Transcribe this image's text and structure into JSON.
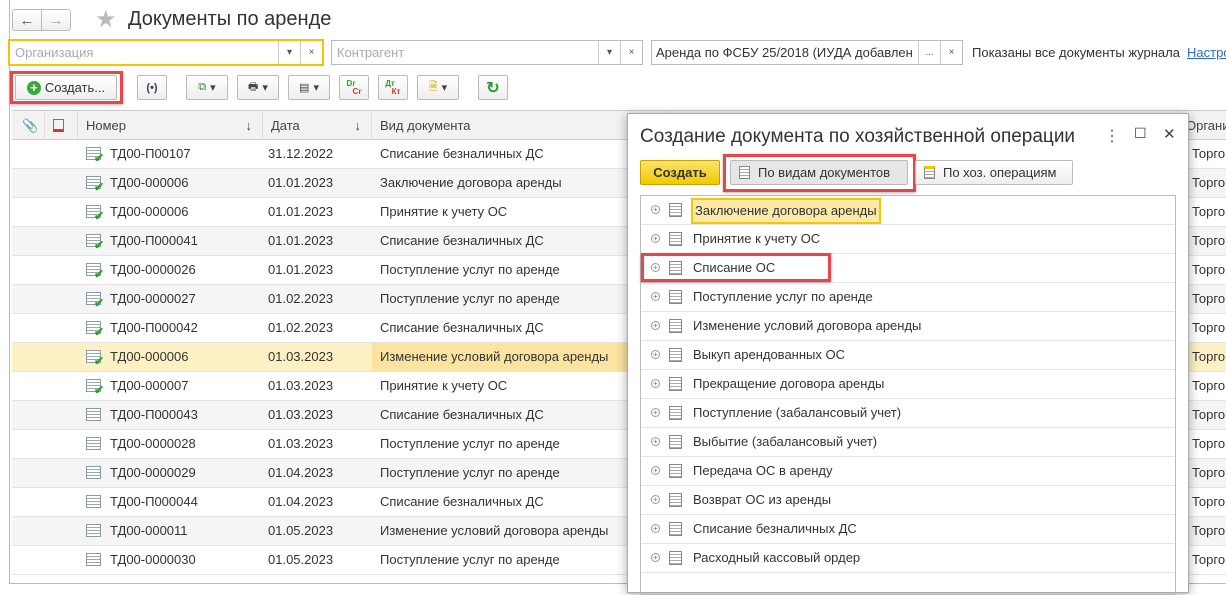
{
  "header": {
    "back": "←",
    "forward": "→",
    "title": "Документы по аренде"
  },
  "filters": {
    "organization_placeholder": "Организация",
    "counterparty_placeholder": "Контрагент",
    "journal_value": "Аренда по ФСБУ 25/2018 (ИУДА  добавлен",
    "ellipsis": "...",
    "clear": "×",
    "dropdown": "▾",
    "status": "Показаны все документы журнала",
    "settings_link": "Настро"
  },
  "toolbar": {
    "create_label": "Создать...",
    "radio": "(•)",
    "dr_cr": [
      "Dr",
      "Cr"
    ],
    "dt_kt": [
      "Дт",
      "Кт"
    ]
  },
  "table": {
    "columns": [
      "Номер",
      "Дата",
      "Вид документа",
      "Органи"
    ],
    "sort_arrow": "↓",
    "rows": [
      {
        "number": "ТД00-П00107",
        "date": "31.12.2022",
        "kind": "Списание безналичных ДС",
        "org": "Торговы",
        "posted": true
      },
      {
        "number": "ТД00-000006",
        "date": "01.01.2023",
        "kind": "Заключение договора аренды",
        "org": "Торговы",
        "posted": true
      },
      {
        "number": "ТД00-000006",
        "date": "01.01.2023",
        "kind": "Принятие к учету ОС",
        "org": "Торговы",
        "posted": true
      },
      {
        "number": "ТД00-П000041",
        "date": "01.01.2023",
        "kind": "Списание безналичных ДС",
        "org": "Торговы",
        "posted": true
      },
      {
        "number": "ТД00-0000026",
        "date": "01.01.2023",
        "kind": "Поступление услуг по аренде",
        "org": "Торговы",
        "posted": true
      },
      {
        "number": "ТД00-0000027",
        "date": "01.02.2023",
        "kind": "Поступление услуг по аренде",
        "org": "Торговы",
        "posted": true
      },
      {
        "number": "ТД00-П000042",
        "date": "01.02.2023",
        "kind": "Списание безналичных ДС",
        "org": "Торговы",
        "posted": true
      },
      {
        "number": "ТД00-000006",
        "date": "01.03.2023",
        "kind": "Изменение условий договора аренды",
        "org": "Торговы",
        "posted": true,
        "selected": true
      },
      {
        "number": "ТД00-000007",
        "date": "01.03.2023",
        "kind": "Принятие к учету ОС",
        "org": "Торговы",
        "posted": true
      },
      {
        "number": "ТД00-П000043",
        "date": "01.03.2023",
        "kind": "Списание безналичных ДС",
        "org": "Торговы",
        "posted": false
      },
      {
        "number": "ТД00-0000028",
        "date": "01.03.2023",
        "kind": "Поступление услуг по аренде",
        "org": "Торговы",
        "posted": false
      },
      {
        "number": "ТД00-0000029",
        "date": "01.04.2023",
        "kind": "Поступление услуг по аренде",
        "org": "Торговы",
        "posted": false
      },
      {
        "number": "ТД00-П000044",
        "date": "01.04.2023",
        "kind": "Списание безналичных ДС",
        "org": "Торговы",
        "posted": false
      },
      {
        "number": "ТД00-000011",
        "date": "01.05.2023",
        "kind": "Изменение условий договора аренды",
        "org": "Торговы",
        "posted": false
      },
      {
        "number": "ТД00-0000030",
        "date": "01.05.2023",
        "kind": "Поступление услуг по аренде",
        "org": "Торговы",
        "posted": false
      }
    ]
  },
  "popup": {
    "title": "Создание документа по хозяйственной операции",
    "menu": "⋮",
    "maximize": "☐",
    "close": "✕",
    "create": "Создать",
    "by_doc_types": "По видам документов",
    "by_operations": "По хоз. операциям",
    "items": [
      "Заключение договора аренды",
      "Принятие к учету ОС",
      "Списание ОС",
      "Поступление услуг по аренде",
      "Изменение условий договора аренды",
      "Выкуп арендованных ОС",
      "Прекращение договора аренды",
      "Поступление (забалансовый учет)",
      "Выбытие (забалансовый учет)",
      "Передача ОС в аренду",
      "Возврат ОС из аренды",
      "Списание безналичных ДС",
      "Расходный кассовый ордер"
    ]
  },
  "colors": {
    "accent_yellow": "#f5d34a",
    "highlight_red": "#e8474a",
    "posted_green": "#2a9d2a",
    "link": "#2a6ebb"
  }
}
